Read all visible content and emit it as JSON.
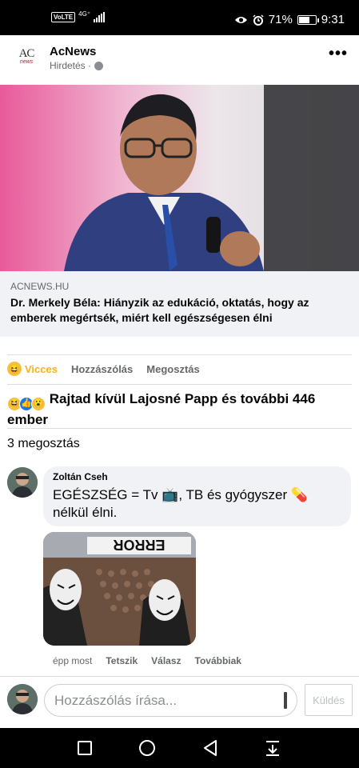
{
  "status_bar": {
    "volte": "VoLTE",
    "network": "4G⁺",
    "battery": "71%",
    "battery_level": 0.71,
    "time": "9:31"
  },
  "post": {
    "page_name": "AcNews",
    "logo_text": "AC",
    "logo_sub": "news",
    "sponsored": "Hirdetés ·",
    "link": {
      "domain": "ACNEWS.HU",
      "headline": "Dr. Merkely Béla: Hiányzik az edukáció, oktatás, hogy az emberek megértsék, miért kell egészségesen élni"
    },
    "actions": {
      "react_label": "Vicces",
      "comment_label": "Hozzászólás",
      "share_label": "Megosztás"
    },
    "reactions_summary": "Rajtad kívül Lajosné Papp és további 446 ember",
    "shares_text": "3 megosztás"
  },
  "comment": {
    "author": "Zoltán Cseh",
    "text_1": "EGÉSZSÉG = Tv",
    "text_2": ", TB és gyógyszer",
    "text_3": "nélkül élni.",
    "photo_sign": "ERROR",
    "time": "épp most",
    "like": "Tetszik",
    "reply": "Válasz",
    "more": "Továbbiak"
  },
  "composer": {
    "placeholder": "Hozzászólás írása...",
    "send": "Küldés"
  },
  "colors": {
    "accent": "#1877f2",
    "haha": "#f7b125",
    "muted": "#65676b",
    "bubble": "#f0f2f5"
  }
}
